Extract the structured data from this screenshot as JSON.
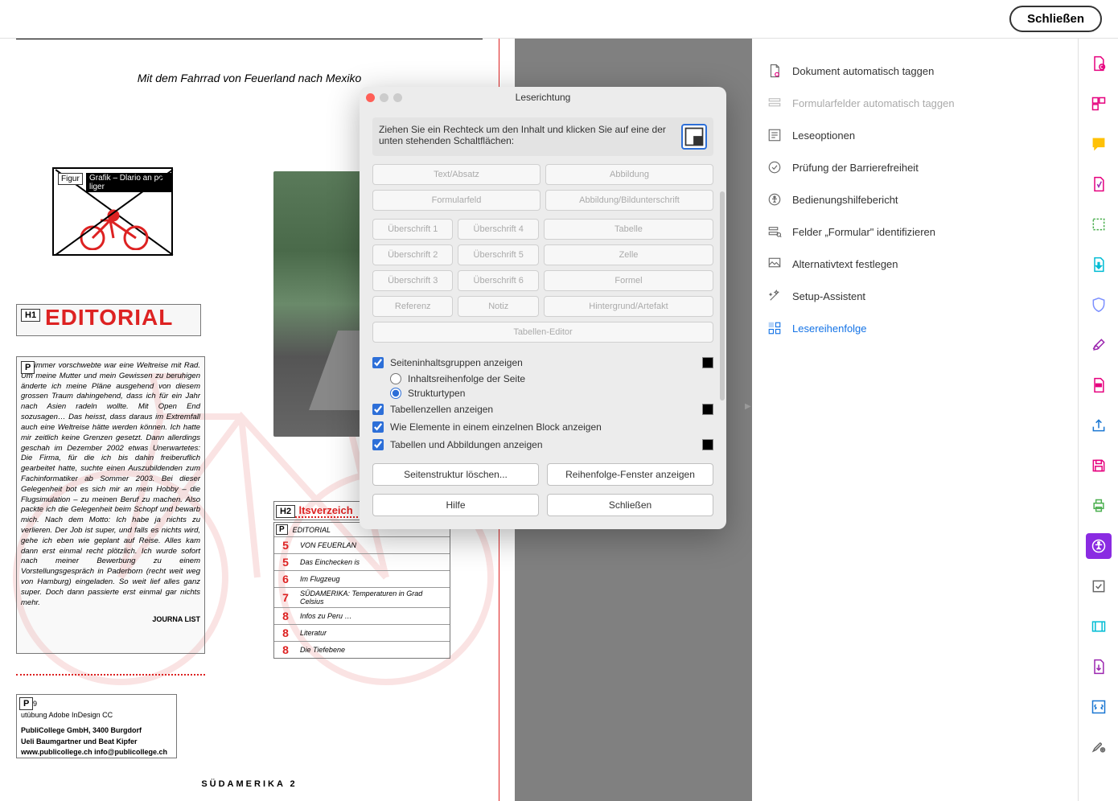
{
  "topbar": {
    "close": "Schließen"
  },
  "doc": {
    "header": "Mit dem Fahrrad von Feuerland nach Mexiko",
    "figure": {
      "badge": "Figur",
      "text": "Grafik – Dlario an po liger"
    },
    "editorial": {
      "badge": "H1",
      "title": "EDITORIAL"
    },
    "para": {
      "badge": "P",
      "text": "mir immer vorschwebte war eine Weltreise mit Rad. Um meine Mutter und mein Gewissen zu beruhigen änderte ich meine Pläne ausgehend von diesem grossen Traum dahingehend, dass ich für ein Jahr nach Asien radeln wollte. Mit Open End sozusagen… Das heisst, dass daraus im Extremfall auch eine Weltreise hätte werden können. Ich hatte mir zeitlich keine Grenzen gesetzt. Dann allerdings geschah im Dezember 2002 etwas Unerwartetes: Die Firma, für die ich bis dahin freiberuflich gearbeitet hatte, suchte einen Auszubildenden zum Fachinformatiker ab Sommer 2003. Bei dieser Gelegenheit bot es sich mir an mein Hobby – die Flugsimulation – zu meinen Beruf zu machen. Also packte ich die Gelegenheit beim Schopf und bewarb mich. Nach dem Motto: Ich habe ja nichts zu verlieren. Der Job ist super, und falls es nichts wird, gehe ich eben wie geplant auf Reise. Alles kam dann erst einmal recht plötzlich. Ich wurde sofort nach meiner Bewerbung zu einem Vorstellungsgespräch in Paderborn (recht weit weg von Hamburg) eingeladen. So weit lief alles ganz super. Doch dann passierte erst einmal gar nichts mehr.",
      "journa": "JOURNA LIST"
    },
    "credit": {
      "badge": "P",
      "year": "2019",
      "line1": "utübung Adobe InDesign CC",
      "line2": "PubliCollege GmbH, 3400 Burgdorf",
      "line3": "Ueli Baumgartner und Beat Kipfer",
      "line4": "www.publicollege.ch   info@publicollege.ch"
    },
    "toc": {
      "badge": "H2",
      "title": "ltsverzeich",
      "rows": [
        {
          "badge": "P",
          "num": "",
          "label": "EDITORIAL"
        },
        {
          "num": "5",
          "label": "VON FEUERLAN"
        },
        {
          "num": "5",
          "label": "Das Einchecken is"
        },
        {
          "num": "6",
          "label": "Im Flugzeug"
        },
        {
          "num": "7",
          "label": "SÜDAMERIKA: Temperaturen in Grad Celsius"
        },
        {
          "num": "8",
          "label": "Infos zu Peru …"
        },
        {
          "num": "8",
          "label": "Literatur"
        },
        {
          "num": "8",
          "label": "Die Tiefebene"
        }
      ]
    },
    "footer": "SÜDAMERIKA     2"
  },
  "dialog": {
    "title": "Leserichtung",
    "instruction": "Ziehen Sie ein Rechteck um den Inhalt und klicken Sie auf eine der unten stehenden Schaltflächen:",
    "buttons": {
      "text": "Text/Absatz",
      "abbildung": "Abbildung",
      "formular": "Formularfeld",
      "abb_unter": "Abbildung/Bildunterschrift",
      "h1": "Überschrift 1",
      "h4": "Überschrift 4",
      "tabelle": "Tabelle",
      "h2": "Überschrift 2",
      "h5": "Überschrift 5",
      "zelle": "Zelle",
      "h3": "Überschrift 3",
      "h6": "Überschrift 6",
      "formel": "Formel",
      "ref": "Referenz",
      "notiz": "Notiz",
      "hintergrund": "Hintergrund/Artefakt",
      "tabellen_editor": "Tabellen-Editor"
    },
    "checks": {
      "seiteninhalt": "Seiteninhaltsgruppen anzeigen",
      "inhaltsreihenfolge": "Inhaltsreihenfolge der Seite",
      "strukturtypen": "Strukturtypen",
      "tabellenzellen": "Tabellenzellen anzeigen",
      "wie_elemente": "Wie Elemente in einem einzelnen Block anzeigen",
      "tabellen_abb": "Tabellen und Abbildungen anzeigen"
    },
    "footer_btns": {
      "loeschen": "Seitenstruktur löschen...",
      "reihenfolge": "Reihenfolge-Fenster anzeigen",
      "hilfe": "Hilfe",
      "schliessen": "Schließen"
    }
  },
  "tools": [
    {
      "id": "auto-tag",
      "label": "Dokument automatisch taggen",
      "state": "normal"
    },
    {
      "id": "form-tag",
      "label": "Formularfelder automatisch taggen",
      "state": "disabled"
    },
    {
      "id": "read-opts",
      "label": "Leseoptionen",
      "state": "normal"
    },
    {
      "id": "a11y-check",
      "label": "Prüfung der Barrierefreiheit",
      "state": "normal"
    },
    {
      "id": "a11y-report",
      "label": "Bedienungshilfebericht",
      "state": "normal"
    },
    {
      "id": "identify-fields",
      "label": "Felder „Formular\" identifizieren",
      "state": "normal"
    },
    {
      "id": "alt-text",
      "label": "Alternativtext festlegen",
      "state": "normal"
    },
    {
      "id": "setup-wizard",
      "label": "Setup-Assistent",
      "state": "normal"
    },
    {
      "id": "reading-order",
      "label": "Lesereihenfolge",
      "state": "active"
    }
  ],
  "rail_icons": [
    "create-pdf",
    "organize",
    "comment",
    "stamp",
    "measure",
    "export",
    "shield",
    "sign",
    "redact",
    "share",
    "save",
    "print",
    "accessibility",
    "validate",
    "video",
    "arrow-down",
    "code",
    "settings"
  ]
}
